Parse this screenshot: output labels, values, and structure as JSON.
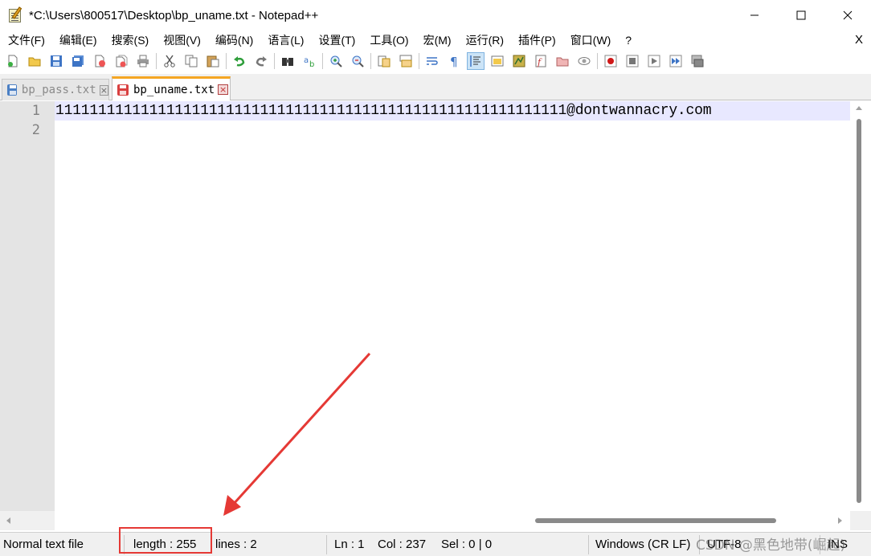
{
  "window": {
    "title": "*C:\\Users\\800517\\Desktop\\bp_uname.txt - Notepad++"
  },
  "menu": {
    "items": [
      "文件(F)",
      "编辑(E)",
      "搜索(S)",
      "视图(V)",
      "编码(N)",
      "语言(L)",
      "设置(T)",
      "工具(O)",
      "宏(M)",
      "运行(R)",
      "插件(P)",
      "窗口(W)",
      "?"
    ],
    "close": "X"
  },
  "tabs": [
    {
      "label": "bp_pass.txt",
      "active": false,
      "close": "×"
    },
    {
      "label": "bp_uname.txt",
      "active": true,
      "close": "×"
    }
  ],
  "editor": {
    "line_numbers": [
      "1",
      "2"
    ],
    "lines": [
      "111111111111111111111111111111111111111111111111111111111111@dontwannacry.com",
      ""
    ]
  },
  "statusbar": {
    "file_type": "Normal text file",
    "length": "length : 255",
    "lines": "lines : 2",
    "ln": "Ln : 1",
    "col": "Col : 237",
    "sel": "Sel : 0 | 0",
    "eol": "Windows (CR LF)",
    "encoding": "UTF-8",
    "mode": "INS"
  },
  "watermark": "CSDN @黑色地带(崛起)",
  "colors": {
    "annotation": "#e53935",
    "current_line": "#e8e8ff",
    "gutter": "#e4e4e4",
    "active_tab_accent": "#f5a623"
  },
  "icons": [
    "new-file-icon",
    "open-file-icon",
    "save-icon",
    "save-all-icon",
    "close-icon",
    "close-all-icon",
    "print-icon",
    "cut-icon",
    "copy-icon",
    "paste-icon",
    "undo-icon",
    "redo-icon",
    "find-icon",
    "replace-icon",
    "zoom-in-icon",
    "zoom-out-icon",
    "sync-v-icon",
    "sync-h-icon",
    "word-wrap-icon",
    "show-all-chars-icon",
    "indent-guide-icon",
    "doc-map-icon",
    "function-list-icon",
    "folder-workspace-icon",
    "monitoring-icon",
    "record-macro-icon",
    "stop-macro-icon",
    "play-macro-icon",
    "run-macro-multiple-icon",
    "save-macro-icon"
  ]
}
